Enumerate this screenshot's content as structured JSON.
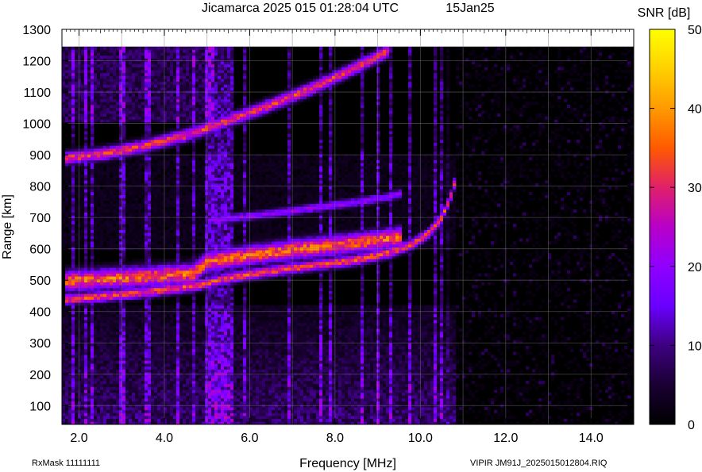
{
  "chart_data": {
    "type": "heatmap",
    "title": "Jicamarca 2025 015 01:28:04 UTC",
    "date_label": "15Jan25",
    "xlabel": "Frequency [MHz]",
    "ylabel": "Range [km]",
    "xlim": [
      1.6,
      15.0
    ],
    "ylim": [
      40,
      1300
    ],
    "data_range_max": 1245,
    "x_ticks": [
      "2.0",
      "4.0",
      "6.0",
      "8.0",
      "10.0",
      "12.0",
      "14.0"
    ],
    "x_tick_values": [
      2.0,
      4.0,
      6.0,
      8.0,
      10.0,
      12.0,
      14.0
    ],
    "y_ticks": [
      "100",
      "200",
      "300",
      "400",
      "500",
      "600",
      "700",
      "800",
      "900",
      "1000",
      "1100",
      "1200",
      "1300"
    ],
    "y_tick_values": [
      100,
      200,
      300,
      400,
      500,
      600,
      700,
      800,
      900,
      1000,
      1100,
      1200,
      1300
    ],
    "grid": true,
    "colorbar": {
      "label": "SNR [dB]",
      "min": 0,
      "max": 50,
      "ticks": [
        "0",
        "10",
        "20",
        "30",
        "40",
        "50"
      ],
      "tick_values": [
        0,
        10,
        20,
        30,
        40,
        50
      ],
      "colormap": [
        "#000000",
        "#1a0033",
        "#3d0080",
        "#6a00ff",
        "#8f00ff",
        "#b800c8",
        "#e0206a",
        "#ff5a00",
        "#ff9a00",
        "#ffd000",
        "#ffff00"
      ]
    },
    "traces": [
      {
        "name": "",
        "kind": "lower-O",
        "freq": [
          1.7,
          2.5,
          3.5,
          4.7,
          5.5,
          6.5,
          7.5,
          8.5,
          9.3,
          9.8,
          10.2,
          10.5,
          10.7,
          10.8
        ],
        "range": [
          440,
          448,
          462,
          482,
          508,
          530,
          548,
          565,
          590,
          615,
          650,
          700,
          760,
          810
        ],
        "snr": 35,
        "width": 12
      },
      {
        "name": "",
        "kind": "upper-band",
        "freq": [
          1.7,
          2.5,
          3.5,
          4.7,
          5.0,
          6.0,
          7.0,
          8.0,
          9.0,
          9.6
        ],
        "range": [
          498,
          504,
          512,
          522,
          560,
          580,
          598,
          612,
          628,
          640
        ],
        "snr": 38,
        "width": 22
      },
      {
        "name": "",
        "kind": "second-band",
        "freq": [
          5.0,
          6.0,
          7.0,
          8.0,
          9.0,
          9.6
        ],
        "range": [
          690,
          705,
          722,
          740,
          760,
          778
        ],
        "snr": 22,
        "width": 10
      },
      {
        "name": "",
        "kind": "multi-hop",
        "freq": [
          1.7,
          2.5,
          3.5,
          4.5,
          5.5,
          6.5,
          7.5,
          8.5,
          9.3
        ],
        "range": [
          890,
          902,
          928,
          962,
          1010,
          1060,
          1115,
          1180,
          1235
        ],
        "snr": 34,
        "width": 14
      }
    ],
    "footer": {
      "rxmask": "RxMask 11111111",
      "source": "VIPIR  JM91J_2025015012804.RIQ"
    }
  }
}
